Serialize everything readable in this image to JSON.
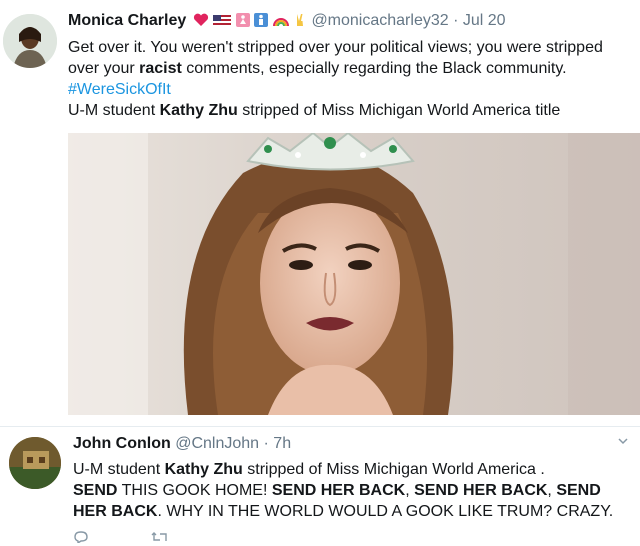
{
  "tweets": [
    {
      "name": "Monica Charley",
      "handle": "@monicacharley32",
      "separator": "·",
      "time": "Jul 20",
      "text_parts": [
        "Get over it. You weren't stripped over your political views; you were stripped over your ",
        "racist",
        " comments, especially regarding the Black community. ",
        "#WereSickOfIt"
      ],
      "linked_title_parts": [
        "U-M student ",
        "Kathy Zhu",
        " stripped of Miss Michigan World America title"
      ],
      "emojis": [
        "heart",
        "us-flag",
        "woman-sign",
        "man-sign",
        "rainbow",
        "victory-hand"
      ]
    },
    {
      "name": "John Conlon",
      "handle": "@CnlnJohn",
      "separator": "·",
      "time": "7h",
      "text_parts": [
        "U-M student ",
        "Kathy Zhu",
        " stripped of Miss Michigan World America .",
        "SEND",
        " THIS GOOK HOME! ",
        "SEND HER BACK",
        ", ",
        "SEND HER BACK",
        ", ",
        "SEND HER BACK",
        ". WHY IN THE WORLD WOULD A GOOK LIKE TRUM? CRAZY."
      ]
    }
  ],
  "colors": {
    "link": "#1b95e0",
    "secondary": "#657786",
    "heart": "#e0245e"
  }
}
